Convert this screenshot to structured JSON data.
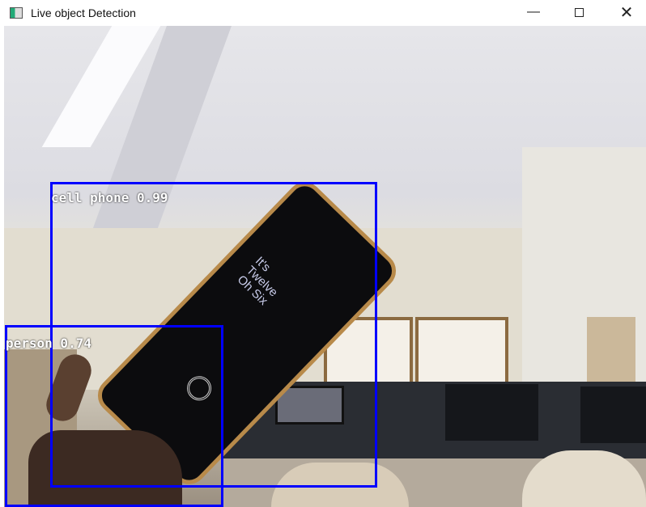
{
  "window": {
    "title": "Live object Detection",
    "minimize_icon": "minimize-icon",
    "maximize_icon": "maximize-icon",
    "close_icon": "close-icon"
  },
  "detections": [
    {
      "label": "cell phone 0.99",
      "class": "cell phone",
      "confidence": 0.99
    },
    {
      "label": "person 0.74",
      "class": "person",
      "confidence": 0.74
    }
  ],
  "colors": {
    "box": "#0000ff",
    "label_text": "#ffffff"
  },
  "phone_screen": {
    "text": "It's\nTwelve\nOh Six"
  }
}
